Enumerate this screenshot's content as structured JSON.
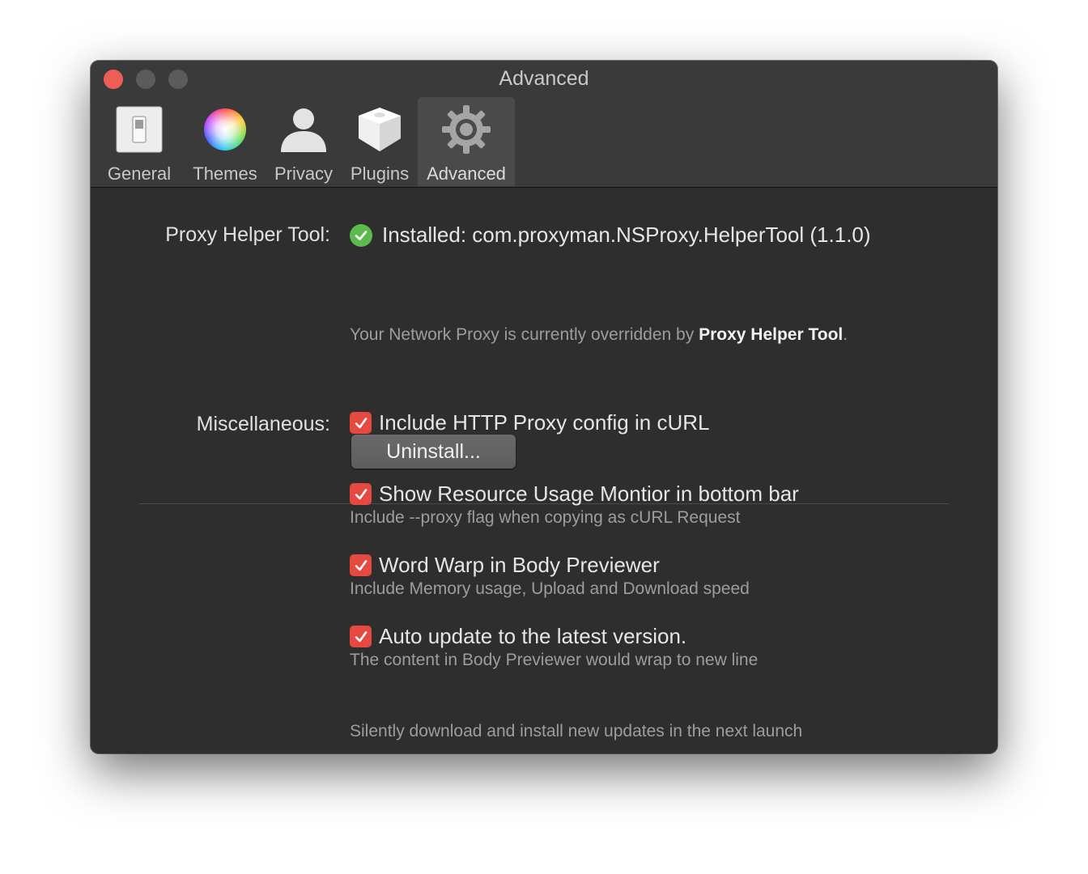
{
  "window": {
    "title": "Advanced"
  },
  "toolbar": {
    "items": [
      {
        "label": "General",
        "icon": "switch-icon"
      },
      {
        "label": "Themes",
        "icon": "color-wheel-icon"
      },
      {
        "label": "Privacy",
        "icon": "person-icon"
      },
      {
        "label": "Plugins",
        "icon": "plugin-box-icon"
      },
      {
        "label": "Advanced",
        "icon": "gear-icon",
        "selected": true
      }
    ]
  },
  "helper": {
    "label": "Proxy Helper Tool:",
    "status": "Installed: com.proxyman.NSProxy.HelperTool (1.1.0)",
    "status_icon": "check-circle-icon",
    "desc_prefix": "Your Network Proxy is currently overridden by ",
    "desc_bold": "Proxy Helper Tool",
    "desc_suffix": ".",
    "uninstall_label": "Uninstall..."
  },
  "misc": {
    "label": "Miscellaneous:",
    "options": [
      {
        "label": "Include HTTP Proxy config in cURL",
        "desc": "Include --proxy flag when copying as cURL Request",
        "checked": true
      },
      {
        "label": "Show Resource Usage Montior in bottom bar",
        "desc": "Include Memory usage, Upload and Download speed",
        "checked": true
      },
      {
        "label": "Word Warp in Body Previewer",
        "desc": "The content in Body Previewer would wrap to new line",
        "checked": true
      },
      {
        "label": "Auto update to the latest version.",
        "desc": "Silently download and install new updates in the next launch",
        "checked": true
      }
    ]
  },
  "colors": {
    "checkbox": "#e5493f",
    "installed": "#5dbb4d",
    "close": "#ed5f56",
    "window_bg": "#2e2e2f"
  }
}
